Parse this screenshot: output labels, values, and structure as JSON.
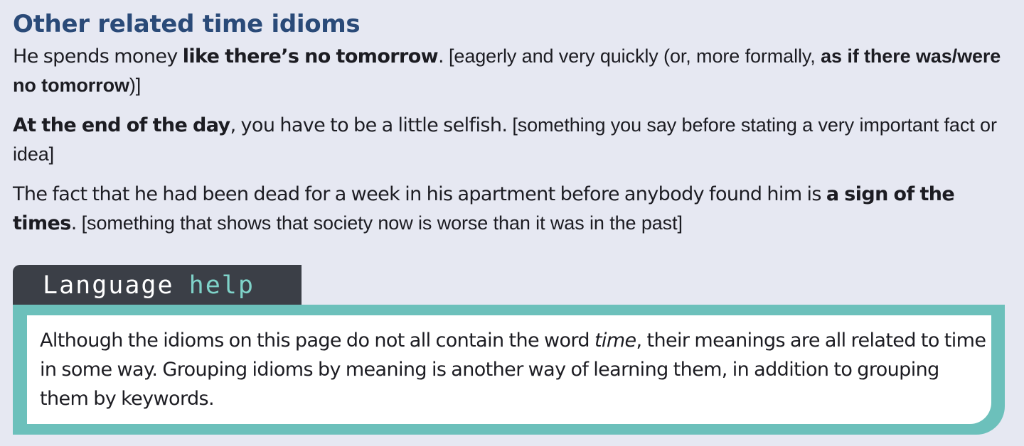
{
  "section": {
    "title": "Other related time idioms"
  },
  "entries": [
    {
      "before": "He spends money ",
      "idiom": "like there’s no tomorrow",
      "after": ". ",
      "gloss_before": "[eagerly and very quickly (or, more formally, ",
      "gloss_idiom": "as if there was/were no tomorrow",
      "gloss_after": ")]"
    },
    {
      "before": "",
      "idiom": "At the end of the day",
      "after": ", you have to be a little selfish. ",
      "gloss": "[something you say before stating a very important fact or idea]"
    },
    {
      "before": "The fact that he had been dead for a week in his apartment before anybody found him is ",
      "idiom": "a sign of the times",
      "after": ". ",
      "gloss": "[something that shows that society now is worse than it was in the past]"
    }
  ],
  "language_help": {
    "title_word_1": "Language",
    "title_word_2": "help",
    "text_before": "Although the idioms on this page do not all contain the word ",
    "text_italic": "time",
    "text_after": ", their meanings are all related to time in some way. Grouping idioms by meaning is another way of learning them, in addition to grouping them by keywords."
  },
  "colors": {
    "heading": "#2a4a78",
    "tab_background": "#3b3f47",
    "tab_accent": "#7fd3c9",
    "box_border": "#6cc0bb",
    "page_background": "#e6e8f2"
  }
}
